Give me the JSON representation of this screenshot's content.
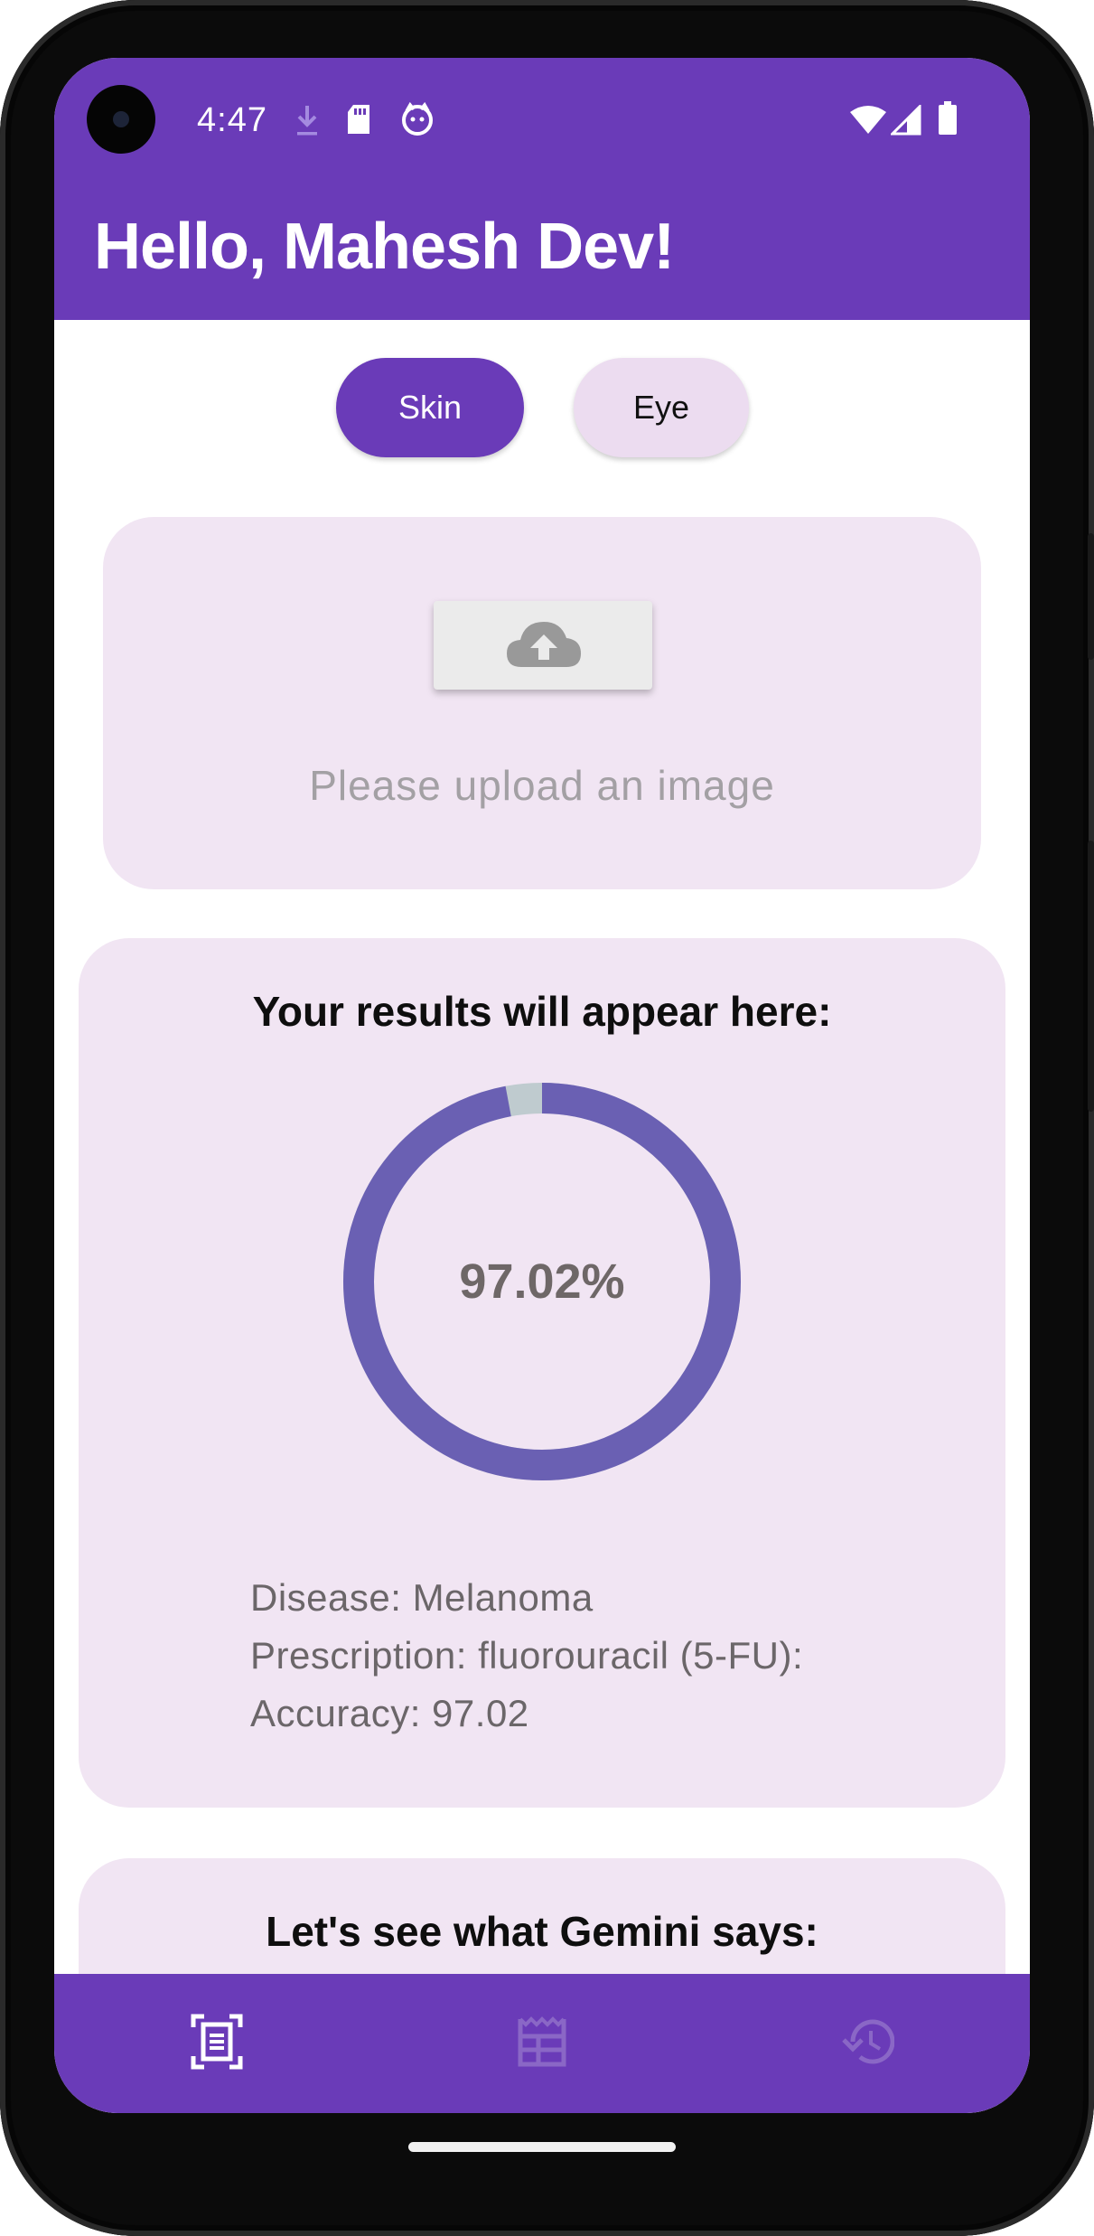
{
  "status_bar": {
    "time": "4:47",
    "left_icons": [
      "download-icon",
      "sd-card-icon",
      "notification-app-icon"
    ],
    "right_icons": [
      "wifi-icon",
      "signal-icon",
      "battery-icon"
    ]
  },
  "header": {
    "greeting": "Hello, Mahesh Dev!"
  },
  "chips": {
    "skin": "Skin",
    "eye": "Eye",
    "selected": "Skin"
  },
  "upload": {
    "button_icon": "cloud-upload-icon",
    "hint": "Please upload an image"
  },
  "results": {
    "title": "Your results will appear here:",
    "progress_percent": 97.02,
    "progress_label": "97.02%",
    "disease": "Disease: Melanoma",
    "prescription": "Prescription: fluorouracil (5-FU):",
    "accuracy": "Accuracy: 97.02"
  },
  "gemini": {
    "title": "Let's see what Gemini says:"
  },
  "bottom_nav": {
    "items": [
      {
        "icon": "document-scanner-icon",
        "active": true
      },
      {
        "icon": "calendar-view-icon",
        "active": false
      },
      {
        "icon": "history-icon",
        "active": false
      }
    ]
  },
  "colors": {
    "primary": "#6a3bb8",
    "surface": "#f1e5f3",
    "ring": "#6a60b3",
    "ring_track": "#bfcbcf",
    "inactive_icon": "#8a67c6"
  }
}
